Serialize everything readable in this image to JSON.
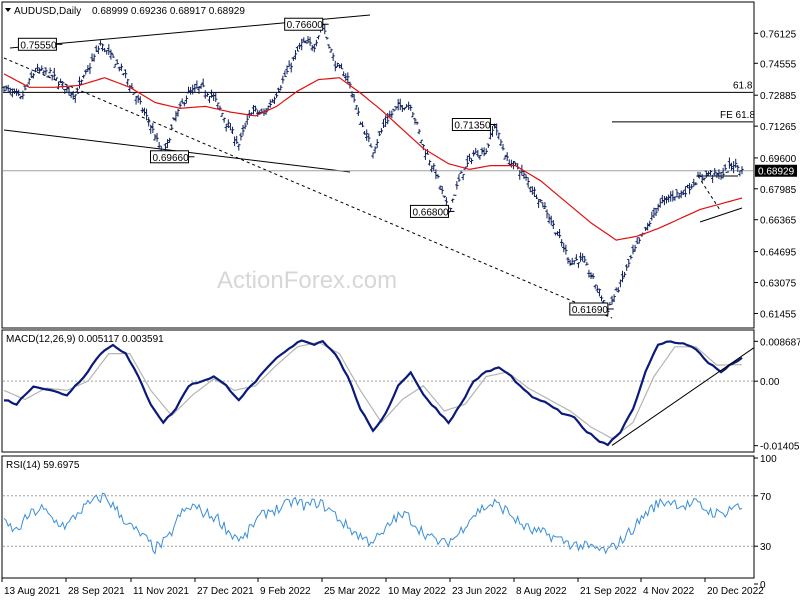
{
  "header": {
    "symbol": "AUDUSD,Daily",
    "ohlc": "0.68999 0.69236 0.68917 0.68929"
  },
  "watermark": "ActionForex.com",
  "chart_data": {
    "type": "candlestick",
    "price_axis": {
      "ticks": [
        "0.76125",
        "0.74555",
        "0.72885",
        "0.71265",
        "0.69600",
        "0.67985",
        "0.66365",
        "0.64695",
        "0.63075",
        "0.61455"
      ],
      "range": [
        0.608,
        0.7745
      ]
    },
    "current_price": "0.68929",
    "x_labels": [
      "13 Aug 2021",
      "28 Sep 2021",
      "11 Nov 2021",
      "27 Dec 2021",
      "9 Feb 2022",
      "25 Mar 2022",
      "10 May 2022",
      "23 Jun 2022",
      "8 Aug 2022",
      "21 Sep 2022",
      "4 Nov 2022",
      "20 Dec 2022"
    ],
    "annotations": [
      {
        "text": "0.76600",
        "value": 0.766,
        "date_index": 152
      },
      {
        "text": "0.75550",
        "value": 0.7555,
        "date_index": 25
      },
      {
        "text": "0.69660",
        "value": 0.6966,
        "date_index": 88
      },
      {
        "text": "0.71350",
        "value": 0.7135,
        "date_index": 232
      },
      {
        "text": "0.66800",
        "value": 0.668,
        "date_index": 212
      },
      {
        "text": "0.61690",
        "value": 0.6169,
        "date_index": 288
      }
    ],
    "levels": [
      {
        "text": "61.8",
        "value": 0.7303
      },
      {
        "text": "FE 61.8",
        "value": 0.7149
      }
    ],
    "price_series": [
      {
        "i": 0,
        "v": 0.733
      },
      {
        "i": 8,
        "v": 0.727
      },
      {
        "i": 15,
        "v": 0.742
      },
      {
        "i": 22,
        "v": 0.74
      },
      {
        "i": 28,
        "v": 0.734
      },
      {
        "i": 34,
        "v": 0.729
      },
      {
        "i": 40,
        "v": 0.742
      },
      {
        "i": 46,
        "v": 0.7555
      },
      {
        "i": 52,
        "v": 0.748
      },
      {
        "i": 58,
        "v": 0.739
      },
      {
        "i": 64,
        "v": 0.726
      },
      {
        "i": 70,
        "v": 0.713
      },
      {
        "i": 76,
        "v": 0.6966
      },
      {
        "i": 82,
        "v": 0.718
      },
      {
        "i": 88,
        "v": 0.73
      },
      {
        "i": 94,
        "v": 0.733
      },
      {
        "i": 100,
        "v": 0.728
      },
      {
        "i": 106,
        "v": 0.715
      },
      {
        "i": 112,
        "v": 0.703
      },
      {
        "i": 118,
        "v": 0.721
      },
      {
        "i": 124,
        "v": 0.719
      },
      {
        "i": 130,
        "v": 0.73
      },
      {
        "i": 136,
        "v": 0.743
      },
      {
        "i": 142,
        "v": 0.756
      },
      {
        "i": 148,
        "v": 0.755
      },
      {
        "i": 152,
        "v": 0.766
      },
      {
        "i": 158,
        "v": 0.745
      },
      {
        "i": 164,
        "v": 0.738
      },
      {
        "i": 170,
        "v": 0.715
      },
      {
        "i": 176,
        "v": 0.7
      },
      {
        "i": 182,
        "v": 0.715
      },
      {
        "i": 188,
        "v": 0.723
      },
      {
        "i": 194,
        "v": 0.724
      },
      {
        "i": 200,
        "v": 0.702
      },
      {
        "i": 206,
        "v": 0.688
      },
      {
        "i": 212,
        "v": 0.668
      },
      {
        "i": 218,
        "v": 0.687
      },
      {
        "i": 224,
        "v": 0.698
      },
      {
        "i": 230,
        "v": 0.7
      },
      {
        "i": 234,
        "v": 0.7135
      },
      {
        "i": 240,
        "v": 0.695
      },
      {
        "i": 246,
        "v": 0.69
      },
      {
        "i": 252,
        "v": 0.68
      },
      {
        "i": 258,
        "v": 0.67
      },
      {
        "i": 264,
        "v": 0.656
      },
      {
        "i": 270,
        "v": 0.642
      },
      {
        "i": 276,
        "v": 0.643
      },
      {
        "i": 282,
        "v": 0.63
      },
      {
        "i": 288,
        "v": 0.6169
      },
      {
        "i": 294,
        "v": 0.63
      },
      {
        "i": 300,
        "v": 0.646
      },
      {
        "i": 306,
        "v": 0.658
      },
      {
        "i": 312,
        "v": 0.671
      },
      {
        "i": 318,
        "v": 0.676
      },
      {
        "i": 324,
        "v": 0.678
      },
      {
        "i": 330,
        "v": 0.684
      },
      {
        "i": 336,
        "v": 0.688
      },
      {
        "i": 342,
        "v": 0.687
      },
      {
        "i": 348,
        "v": 0.693
      },
      {
        "i": 352,
        "v": 0.6893
      }
    ],
    "ma_series": [
      {
        "i": 0,
        "v": 0.74
      },
      {
        "i": 12,
        "v": 0.733
      },
      {
        "i": 24,
        "v": 0.733
      },
      {
        "i": 36,
        "v": 0.734
      },
      {
        "i": 48,
        "v": 0.738
      },
      {
        "i": 60,
        "v": 0.733
      },
      {
        "i": 72,
        "v": 0.725
      },
      {
        "i": 84,
        "v": 0.722
      },
      {
        "i": 96,
        "v": 0.723
      },
      {
        "i": 108,
        "v": 0.72
      },
      {
        "i": 120,
        "v": 0.718
      },
      {
        "i": 130,
        "v": 0.723
      },
      {
        "i": 140,
        "v": 0.731
      },
      {
        "i": 150,
        "v": 0.737
      },
      {
        "i": 160,
        "v": 0.738
      },
      {
        "i": 170,
        "v": 0.73
      },
      {
        "i": 180,
        "v": 0.721
      },
      {
        "i": 190,
        "v": 0.711
      },
      {
        "i": 200,
        "v": 0.701
      },
      {
        "i": 212,
        "v": 0.693
      },
      {
        "i": 222,
        "v": 0.69
      },
      {
        "i": 232,
        "v": 0.692
      },
      {
        "i": 244,
        "v": 0.692
      },
      {
        "i": 256,
        "v": 0.684
      },
      {
        "i": 268,
        "v": 0.673
      },
      {
        "i": 280,
        "v": 0.662
      },
      {
        "i": 292,
        "v": 0.653
      },
      {
        "i": 302,
        "v": 0.655
      },
      {
        "i": 312,
        "v": 0.659
      },
      {
        "i": 322,
        "v": 0.664
      },
      {
        "i": 332,
        "v": 0.669
      },
      {
        "i": 342,
        "v": 0.672
      },
      {
        "i": 352,
        "v": 0.675
      }
    ],
    "macd": {
      "label": "MACD(12,26,9) 0.005117 0.003591",
      "ticks": [
        "0.008687",
        "0.00",
        "-0.014056"
      ],
      "range": [
        -0.015,
        0.0105
      ],
      "macd_series": [
        {
          "i": 0,
          "v": -0.004
        },
        {
          "i": 6,
          "v": -0.005
        },
        {
          "i": 14,
          "v": -0.001
        },
        {
          "i": 22,
          "v": -0.002
        },
        {
          "i": 30,
          "v": -0.003
        },
        {
          "i": 38,
          "v": 0.001
        },
        {
          "i": 46,
          "v": 0.006
        },
        {
          "i": 52,
          "v": 0.008
        },
        {
          "i": 58,
          "v": 0.006
        },
        {
          "i": 64,
          "v": 0.001
        },
        {
          "i": 70,
          "v": -0.005
        },
        {
          "i": 76,
          "v": -0.009
        },
        {
          "i": 82,
          "v": -0.006
        },
        {
          "i": 88,
          "v": -0.001
        },
        {
          "i": 94,
          "v": 0.0
        },
        {
          "i": 100,
          "v": 0.001
        },
        {
          "i": 106,
          "v": -0.001
        },
        {
          "i": 112,
          "v": -0.004
        },
        {
          "i": 118,
          "v": -0.001
        },
        {
          "i": 124,
          "v": 0.002
        },
        {
          "i": 130,
          "v": 0.005
        },
        {
          "i": 136,
          "v": 0.007
        },
        {
          "i": 142,
          "v": 0.009
        },
        {
          "i": 148,
          "v": 0.008
        },
        {
          "i": 152,
          "v": 0.0088
        },
        {
          "i": 158,
          "v": 0.006
        },
        {
          "i": 164,
          "v": 0.001
        },
        {
          "i": 170,
          "v": -0.006
        },
        {
          "i": 176,
          "v": -0.011
        },
        {
          "i": 182,
          "v": -0.007
        },
        {
          "i": 188,
          "v": -0.001
        },
        {
          "i": 194,
          "v": 0.002
        },
        {
          "i": 200,
          "v": -0.003
        },
        {
          "i": 206,
          "v": -0.006
        },
        {
          "i": 212,
          "v": -0.009
        },
        {
          "i": 218,
          "v": -0.005
        },
        {
          "i": 224,
          "v": 0.0
        },
        {
          "i": 230,
          "v": 0.002
        },
        {
          "i": 236,
          "v": 0.003
        },
        {
          "i": 242,
          "v": 0.001
        },
        {
          "i": 248,
          "v": -0.002
        },
        {
          "i": 254,
          "v": -0.004
        },
        {
          "i": 260,
          "v": -0.005
        },
        {
          "i": 266,
          "v": -0.007
        },
        {
          "i": 272,
          "v": -0.008
        },
        {
          "i": 278,
          "v": -0.011
        },
        {
          "i": 284,
          "v": -0.013
        },
        {
          "i": 288,
          "v": -0.0138
        },
        {
          "i": 294,
          "v": -0.011
        },
        {
          "i": 300,
          "v": -0.006
        },
        {
          "i": 306,
          "v": 0.002
        },
        {
          "i": 312,
          "v": 0.008
        },
        {
          "i": 318,
          "v": 0.0087
        },
        {
          "i": 324,
          "v": 0.0082
        },
        {
          "i": 330,
          "v": 0.007
        },
        {
          "i": 336,
          "v": 0.004
        },
        {
          "i": 342,
          "v": 0.002
        },
        {
          "i": 348,
          "v": 0.004
        },
        {
          "i": 352,
          "v": 0.0051
        }
      ],
      "signal_series": [
        {
          "i": 0,
          "v": -0.002
        },
        {
          "i": 10,
          "v": -0.004
        },
        {
          "i": 20,
          "v": -0.0015
        },
        {
          "i": 30,
          "v": -0.002
        },
        {
          "i": 40,
          "v": 0.0
        },
        {
          "i": 50,
          "v": 0.006
        },
        {
          "i": 60,
          "v": 0.006
        },
        {
          "i": 70,
          "v": -0.002
        },
        {
          "i": 80,
          "v": -0.0075
        },
        {
          "i": 90,
          "v": -0.003
        },
        {
          "i": 100,
          "v": 0.0005
        },
        {
          "i": 110,
          "v": -0.002
        },
        {
          "i": 120,
          "v": -0.001
        },
        {
          "i": 130,
          "v": 0.0035
        },
        {
          "i": 140,
          "v": 0.0075
        },
        {
          "i": 150,
          "v": 0.0085
        },
        {
          "i": 160,
          "v": 0.006
        },
        {
          "i": 170,
          "v": -0.002
        },
        {
          "i": 180,
          "v": -0.009
        },
        {
          "i": 190,
          "v": -0.004
        },
        {
          "i": 200,
          "v": -0.001
        },
        {
          "i": 210,
          "v": -0.0065
        },
        {
          "i": 220,
          "v": -0.005
        },
        {
          "i": 230,
          "v": 0.001
        },
        {
          "i": 240,
          "v": 0.002
        },
        {
          "i": 250,
          "v": -0.0015
        },
        {
          "i": 260,
          "v": -0.004
        },
        {
          "i": 270,
          "v": -0.0065
        },
        {
          "i": 280,
          "v": -0.01
        },
        {
          "i": 290,
          "v": -0.0125
        },
        {
          "i": 300,
          "v": -0.009
        },
        {
          "i": 310,
          "v": 0.001
        },
        {
          "i": 320,
          "v": 0.0075
        },
        {
          "i": 330,
          "v": 0.0075
        },
        {
          "i": 340,
          "v": 0.0035
        },
        {
          "i": 352,
          "v": 0.0036
        }
      ],
      "trendline": [
        {
          "i": 290,
          "v": -0.014
        },
        {
          "i": 352,
          "v": 0.0073
        }
      ]
    },
    "rsi": {
      "label": "RSI(14) 59.6975",
      "ticks": [
        "100",
        "70",
        "30",
        "0"
      ],
      "range": [
        0,
        100
      ],
      "series": [
        {
          "i": 0,
          "v": 48
        },
        {
          "i": 6,
          "v": 42
        },
        {
          "i": 12,
          "v": 55
        },
        {
          "i": 18,
          "v": 60
        },
        {
          "i": 24,
          "v": 50
        },
        {
          "i": 30,
          "v": 46
        },
        {
          "i": 36,
          "v": 58
        },
        {
          "i": 42,
          "v": 65
        },
        {
          "i": 48,
          "v": 70
        },
        {
          "i": 54,
          "v": 58
        },
        {
          "i": 60,
          "v": 46
        },
        {
          "i": 66,
          "v": 38
        },
        {
          "i": 72,
          "v": 28
        },
        {
          "i": 78,
          "v": 35
        },
        {
          "i": 84,
          "v": 55
        },
        {
          "i": 90,
          "v": 62
        },
        {
          "i": 96,
          "v": 56
        },
        {
          "i": 102,
          "v": 52
        },
        {
          "i": 108,
          "v": 40
        },
        {
          "i": 114,
          "v": 35
        },
        {
          "i": 120,
          "v": 50
        },
        {
          "i": 126,
          "v": 58
        },
        {
          "i": 132,
          "v": 60
        },
        {
          "i": 138,
          "v": 66
        },
        {
          "i": 144,
          "v": 62
        },
        {
          "i": 150,
          "v": 65
        },
        {
          "i": 156,
          "v": 58
        },
        {
          "i": 162,
          "v": 48
        },
        {
          "i": 168,
          "v": 40
        },
        {
          "i": 174,
          "v": 34
        },
        {
          "i": 180,
          "v": 38
        },
        {
          "i": 186,
          "v": 52
        },
        {
          "i": 192,
          "v": 55
        },
        {
          "i": 198,
          "v": 44
        },
        {
          "i": 204,
          "v": 36
        },
        {
          "i": 210,
          "v": 32
        },
        {
          "i": 216,
          "v": 38
        },
        {
          "i": 222,
          "v": 52
        },
        {
          "i": 228,
          "v": 60
        },
        {
          "i": 234,
          "v": 64
        },
        {
          "i": 240,
          "v": 58
        },
        {
          "i": 246,
          "v": 48
        },
        {
          "i": 252,
          "v": 42
        },
        {
          "i": 258,
          "v": 40
        },
        {
          "i": 264,
          "v": 36
        },
        {
          "i": 270,
          "v": 32
        },
        {
          "i": 276,
          "v": 30
        },
        {
          "i": 282,
          "v": 28
        },
        {
          "i": 288,
          "v": 26
        },
        {
          "i": 294,
          "v": 34
        },
        {
          "i": 300,
          "v": 44
        },
        {
          "i": 306,
          "v": 56
        },
        {
          "i": 312,
          "v": 64
        },
        {
          "i": 318,
          "v": 66
        },
        {
          "i": 324,
          "v": 62
        },
        {
          "i": 330,
          "v": 64
        },
        {
          "i": 336,
          "v": 58
        },
        {
          "i": 342,
          "v": 55
        },
        {
          "i": 348,
          "v": 62
        },
        {
          "i": 352,
          "v": 59.7
        }
      ]
    }
  }
}
